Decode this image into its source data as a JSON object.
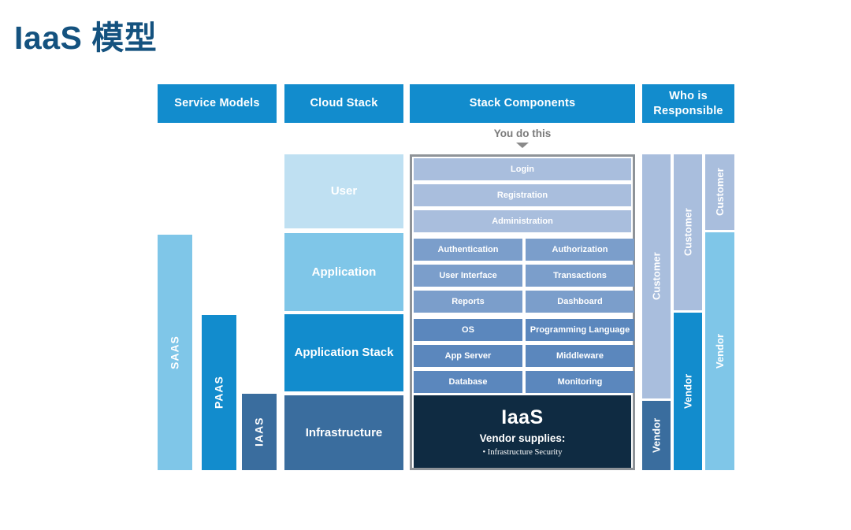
{
  "page": {
    "title": "IaaS 模型",
    "title_color": "#14527f"
  },
  "headers": {
    "service_models": "Service Models",
    "cloud_stack": "Cloud Stack",
    "stack_components": "Stack Components",
    "who_is_responsible": "Who is\nResponsible"
  },
  "annotation": {
    "you_do_this": "You do this"
  },
  "service_models": [
    {
      "label": "SAAS",
      "color": "#7fc6e8"
    },
    {
      "label": "PAAS",
      "color": "#128ccd"
    },
    {
      "label": "IAAS",
      "color": "#3a6d9e"
    }
  ],
  "cloud_stack": [
    {
      "label": "User",
      "color": "#bfe0f2"
    },
    {
      "label": "Application",
      "color": "#7fc6e8"
    },
    {
      "label": "Application Stack",
      "color": "#128ccd"
    },
    {
      "label": "Infrastructure",
      "color": "#3a6d9e"
    }
  ],
  "stack_components": {
    "user_rows": [
      "Login",
      "Registration",
      "Administration"
    ],
    "application_rows": [
      {
        "left": "Authentication",
        "right": "Authorization"
      },
      {
        "left": "User Interface",
        "right": "Transactions"
      },
      {
        "left": "Reports",
        "right": "Dashboard"
      }
    ],
    "application_stack_rows": [
      {
        "left": "OS",
        "right": "Programming Language"
      },
      {
        "left": "App Server",
        "right": "Middleware"
      },
      {
        "left": "Database",
        "right": "Monitoring"
      }
    ],
    "infrastructure_box": {
      "title": "IaaS",
      "subtitle": "Vendor supplies:",
      "items": [
        "• Infrastructure Security"
      ],
      "color": "#0f2b42"
    }
  },
  "responsibility": [
    {
      "top_label": "Customer",
      "bottom_label": "Vendor",
      "top_color": "#a9bedd",
      "bottom_color": "#3a6d9e"
    },
    {
      "top_label": "Customer",
      "bottom_label": "Vendor",
      "top_color": "#a9bedd",
      "bottom_color": "#128ccd"
    },
    {
      "top_label": "Customer",
      "bottom_label": "Vendor",
      "top_color": "#a9bedd",
      "bottom_color": "#7fc6e8"
    }
  ]
}
